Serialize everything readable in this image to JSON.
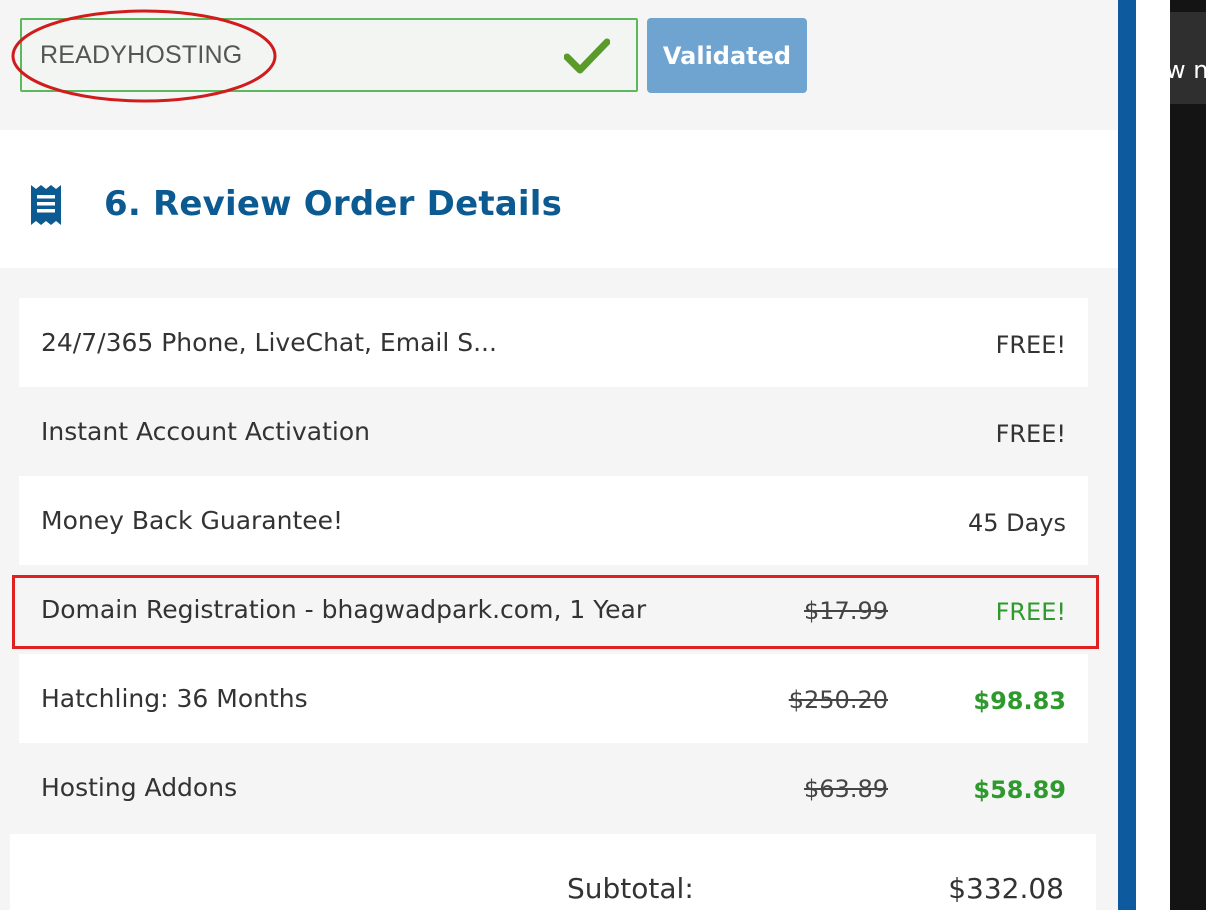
{
  "promo": {
    "code_value": "READYHOSTING",
    "validated_label": "Validated"
  },
  "section": {
    "title": "6. Review Order Details"
  },
  "order_items": [
    {
      "label": "24/7/365 Phone, LiveChat, Email S...",
      "original_price": "",
      "price": "FREE!"
    },
    {
      "label": "Instant Account Activation",
      "original_price": "",
      "price": "FREE!"
    },
    {
      "label": "Money Back Guarantee!",
      "original_price": "",
      "price": "45 Days"
    },
    {
      "label": "Domain Registration - bhagwadpark.com, 1 Year",
      "original_price": "$17.99",
      "price": "FREE!"
    },
    {
      "label": "Hatchling: 36 Months",
      "original_price": "$250.20",
      "price": "$98.83"
    },
    {
      "label": "Hosting Addons",
      "original_price": "$63.89",
      "price": "$58.89"
    }
  ],
  "subtotal": {
    "label": "Subtotal:",
    "value": "$332.08"
  },
  "side_panel": {
    "tab_text": "w n"
  },
  "colors": {
    "accent_blue": "#0b5a91",
    "button_blue": "#6fa3d0",
    "success_green": "#2e9a2e",
    "highlight_red": "#e02121"
  }
}
